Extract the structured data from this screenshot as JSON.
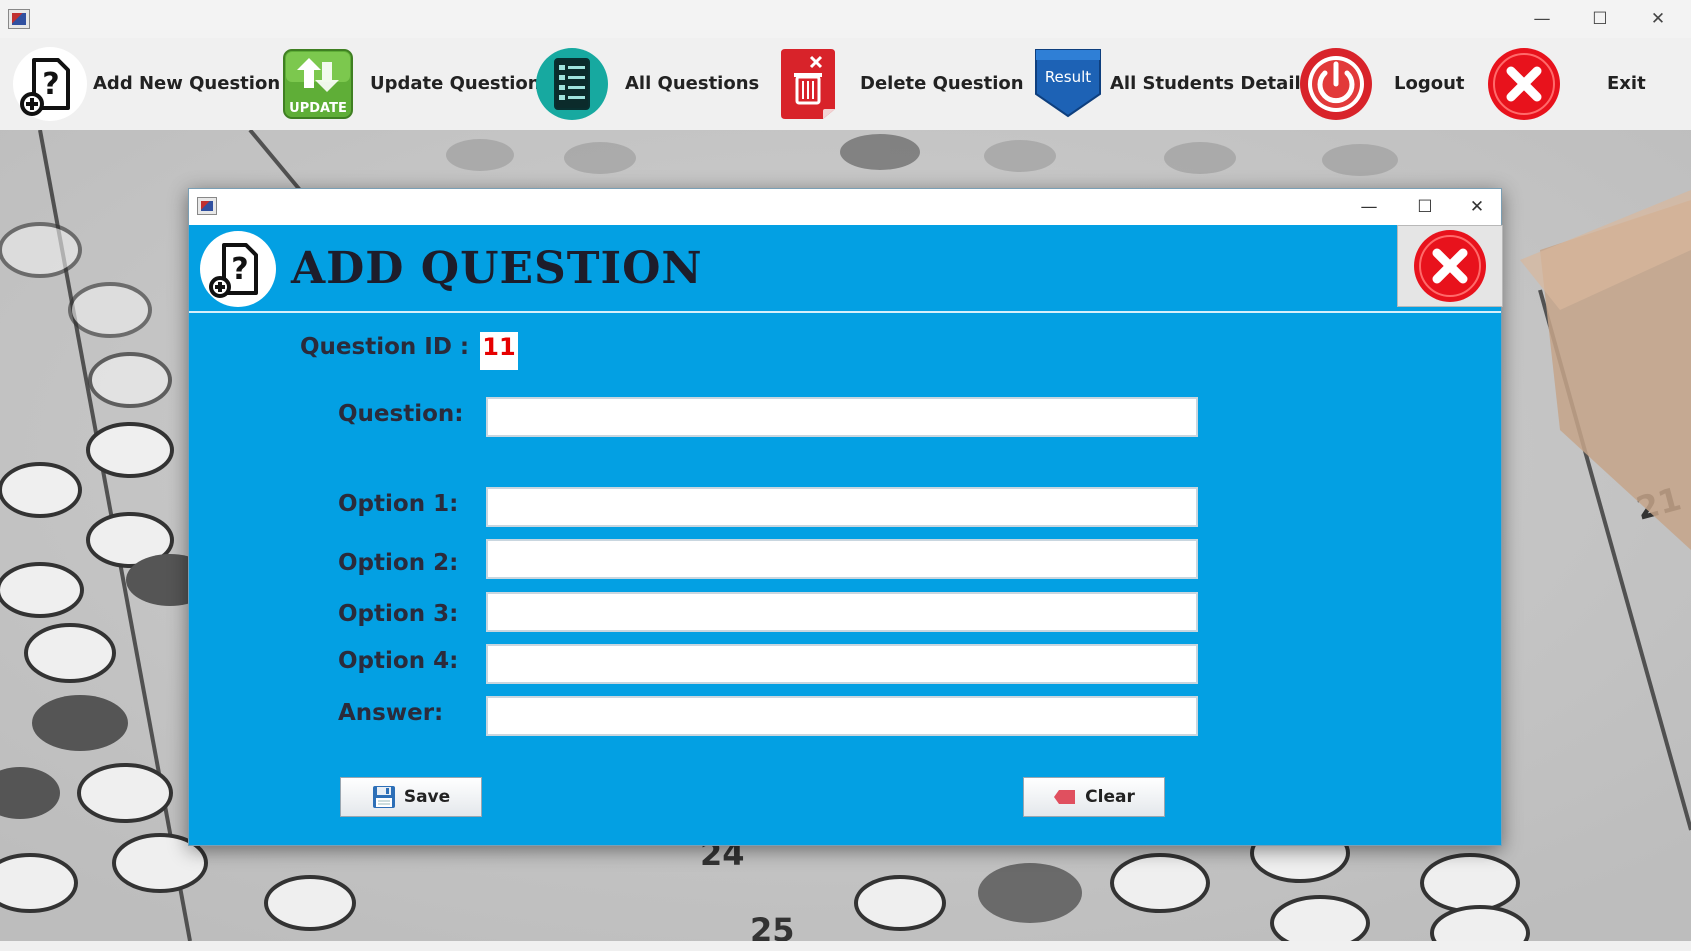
{
  "window": {
    "minimize": "—",
    "maximize": "☐",
    "close": "✕"
  },
  "toolbar": {
    "items": [
      {
        "label": "Add New Question",
        "icon": "add-question-icon"
      },
      {
        "label": "Update Question",
        "icon": "update-icon",
        "icon_text": "UPDATE"
      },
      {
        "label": "All Questions",
        "icon": "list-icon"
      },
      {
        "label": "Delete Question",
        "icon": "trash-icon"
      },
      {
        "label": "All Students Details",
        "icon": "result-icon",
        "icon_text": "Result"
      },
      {
        "label": "Logout",
        "icon": "power-icon"
      },
      {
        "label": "Exit",
        "icon": "close-icon"
      }
    ]
  },
  "background": {
    "numbers": [
      "24",
      "25",
      "21"
    ]
  },
  "dialog": {
    "title": "ADD QUESTION",
    "question_id_label": "Question ID :",
    "question_id_value": "11",
    "fields": [
      {
        "label": "Question:",
        "value": ""
      },
      {
        "label": "Option 1:",
        "value": ""
      },
      {
        "label": "Option 2:",
        "value": ""
      },
      {
        "label": "Option 3:",
        "value": ""
      },
      {
        "label": "Option 4:",
        "value": ""
      },
      {
        "label": "Answer:",
        "value": ""
      }
    ],
    "save_label": "Save",
    "clear_label": "Clear"
  },
  "colors": {
    "dialog_bg": "#03a0e3",
    "id_color": "#e60000",
    "close_red": "#e8121c"
  }
}
